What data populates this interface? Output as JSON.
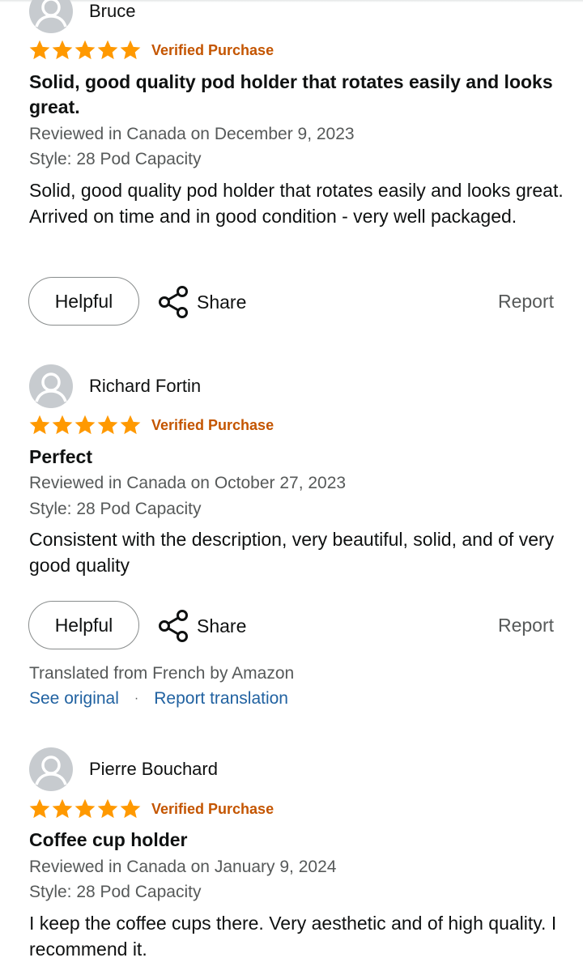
{
  "colors": {
    "star": "#ff9900",
    "verified": "#c45500",
    "link": "#2162a1",
    "muted": "#565959",
    "avatar_bg": "#c7cbcf"
  },
  "icons": [
    "person-avatar-icon",
    "star-icon",
    "share-icon"
  ],
  "reviews": [
    {
      "author": "Bruce",
      "rating": 5,
      "verified_label": "Verified Purchase",
      "title": "Solid, good quality pod holder that rotates easily and looks great.",
      "reviewed_in": "Reviewed in Canada on December 9, 2023",
      "style": "Style: 28 Pod Capacity",
      "body": "Solid, good quality pod holder that rotates easily and looks great. Arrived on time and in good condition - very well packaged.",
      "helpful_label": "Helpful",
      "share_label": "Share",
      "report_label": "Report"
    },
    {
      "author": "Richard Fortin",
      "rating": 5,
      "verified_label": "Verified Purchase",
      "title": "Perfect",
      "reviewed_in": "Reviewed in Canada on October 27, 2023",
      "style": "Style: 28 Pod Capacity",
      "body": "Consistent with the description, very beautiful, solid, and of very good quality",
      "helpful_label": "Helpful",
      "share_label": "Share",
      "report_label": "Report",
      "translated_note": "Translated from French by Amazon",
      "see_original": "See original",
      "separator": "·",
      "report_translation": "Report translation"
    },
    {
      "author": "Pierre Bouchard",
      "rating": 5,
      "verified_label": "Verified Purchase",
      "title": "Coffee cup holder",
      "reviewed_in": "Reviewed in Canada on January 9, 2024",
      "style": "Style: 28 Pod Capacity",
      "body": "I keep the coffee cups there. Very aesthetic and of high quality. I recommend it."
    }
  ]
}
